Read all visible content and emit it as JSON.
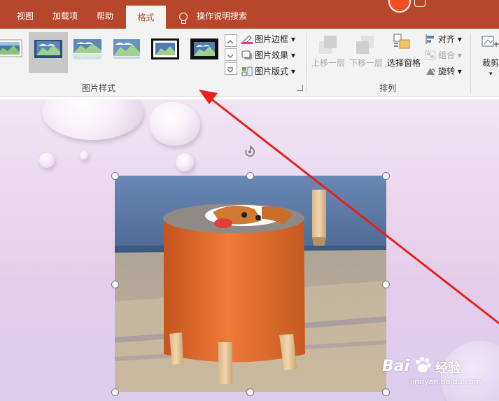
{
  "ribbon_tabs": [
    {
      "label": "视图"
    },
    {
      "label": "加载项"
    },
    {
      "label": "帮助"
    },
    {
      "label": "格式"
    }
  ],
  "active_tab": "格式",
  "search": {
    "label": "操作说明搜索"
  },
  "picture_styles": {
    "group_label": "图片样式",
    "commands": {
      "border": "图片边框",
      "effects": "图片效果",
      "layout": "图片版式"
    }
  },
  "arrange": {
    "group_label": "排列",
    "bring_forward": "上移一层",
    "send_backward": "下移一层",
    "selection_pane": "选择窗格",
    "align": "对齐",
    "group": "组合",
    "rotate": "旋转"
  },
  "size": {
    "crop": "裁剪"
  },
  "watermark": {
    "logo": "Bai",
    "logo_cn": "经验",
    "url": "jingyan.baidu.com"
  },
  "colors": {
    "tab_bar": "#b7472a",
    "ribbon_bg": "#f3f3f3",
    "annotation_arrow": "#e8211c",
    "selection_handle": "#ffffff"
  }
}
